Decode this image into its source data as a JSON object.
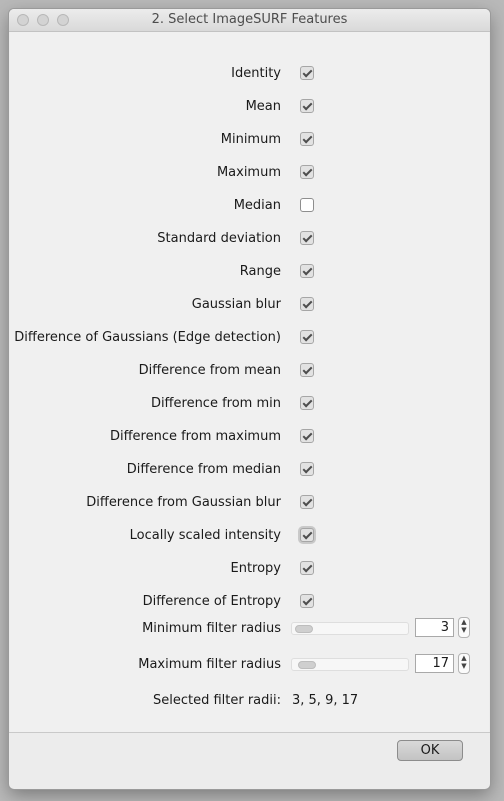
{
  "window": {
    "title": "2. Select ImageSURF Features"
  },
  "features": [
    {
      "label": "Identity",
      "checked": true
    },
    {
      "label": "Mean",
      "checked": true
    },
    {
      "label": "Minimum",
      "checked": true
    },
    {
      "label": "Maximum",
      "checked": true
    },
    {
      "label": "Median",
      "checked": false
    },
    {
      "label": "Standard deviation",
      "checked": true
    },
    {
      "label": "Range",
      "checked": true
    },
    {
      "label": "Gaussian blur",
      "checked": true
    },
    {
      "label": "Difference of Gaussians (Edge detection)",
      "checked": true
    },
    {
      "label": "Difference from mean",
      "checked": true
    },
    {
      "label": "Difference from min",
      "checked": true
    },
    {
      "label": "Difference from maximum",
      "checked": true
    },
    {
      "label": "Difference from median",
      "checked": true
    },
    {
      "label": "Difference from Gaussian blur",
      "checked": true
    },
    {
      "label": "Locally scaled intensity",
      "checked": true,
      "focused": true
    },
    {
      "label": "Entropy",
      "checked": true
    },
    {
      "label": "Difference of Entropy",
      "checked": true
    }
  ],
  "filters": {
    "minimum": {
      "label": "Minimum filter radius",
      "value": "3"
    },
    "maximum": {
      "label": "Maximum filter radius",
      "value": "17"
    }
  },
  "radii": {
    "label": "Selected filter radii:",
    "value": "3, 5, 9, 17"
  },
  "footer": {
    "ok_label": "OK"
  }
}
